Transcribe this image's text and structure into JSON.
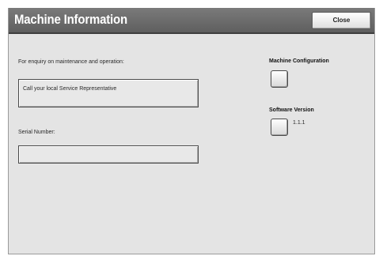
{
  "header": {
    "title": "Machine Information",
    "close_label": "Close"
  },
  "left": {
    "enquiry_label": "For enquiry on maintenance and operation:",
    "enquiry_value": "Call your local Service Representative",
    "serial_label": "Serial Number:",
    "serial_value": ""
  },
  "right": {
    "machine_config_label": "Machine Configuration",
    "software_version_label": "Software Version",
    "software_version_value": "1.1.1"
  }
}
